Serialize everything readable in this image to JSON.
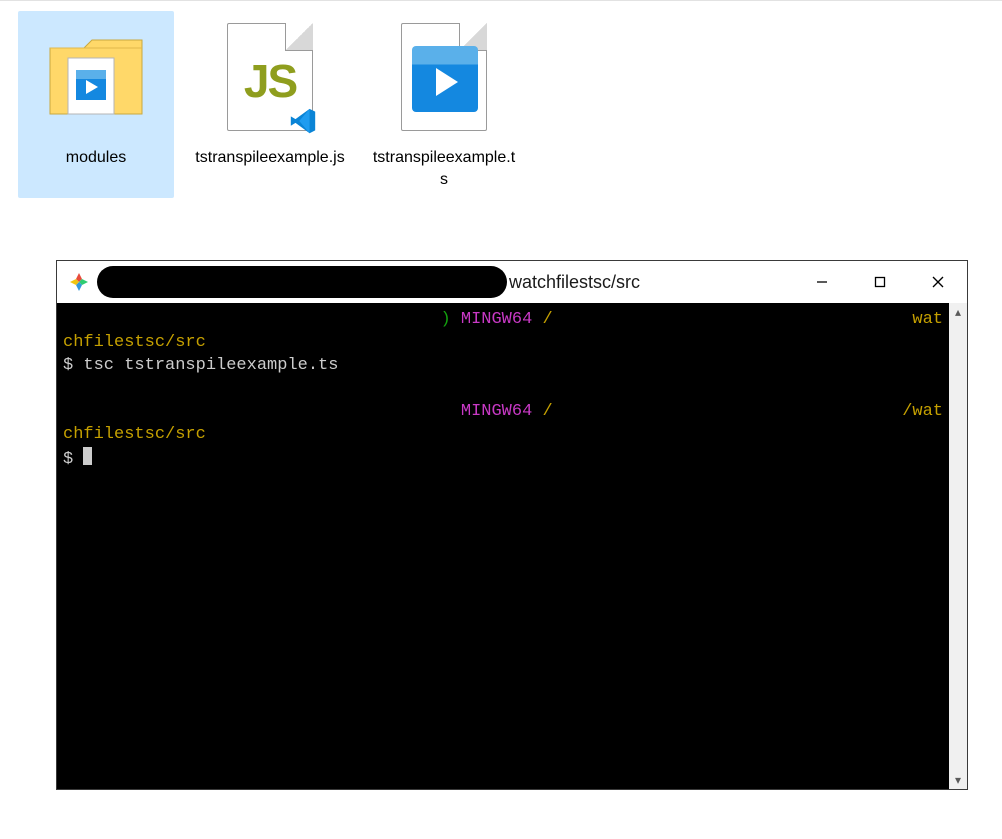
{
  "explorer": {
    "items": [
      {
        "label": "modules",
        "type": "folder",
        "selected": true
      },
      {
        "label": "tstranspileexample.js",
        "type": "jsfile",
        "selected": false
      },
      {
        "label": "tstranspileexample.ts",
        "type": "tsfile",
        "selected": false
      }
    ]
  },
  "terminal_window": {
    "title_path": "watchfilestsc/src",
    "controls": {
      "min": "—",
      "max": "▢",
      "close": "✕"
    }
  },
  "terminal": {
    "lines": [
      {
        "kind": "promptheader",
        "left_green": "                                     ) ",
        "mingw": "MINGW64 ",
        "slash": "/",
        "right_yellow": "wat"
      },
      {
        "kind": "yellow",
        "text": "chfilestsc/src"
      },
      {
        "kind": "cmd",
        "prompt": "$ ",
        "text": "tsc tstranspileexample.ts"
      },
      {
        "kind": "blank",
        "text": ""
      },
      {
        "kind": "promptheader",
        "left_green": "                                       ",
        "mingw": "MINGW64 ",
        "slash": "/",
        "right_yellow": "/wat"
      },
      {
        "kind": "yellow",
        "text": "chfilestsc/src"
      },
      {
        "kind": "cmdcur",
        "prompt": "$ "
      }
    ]
  }
}
